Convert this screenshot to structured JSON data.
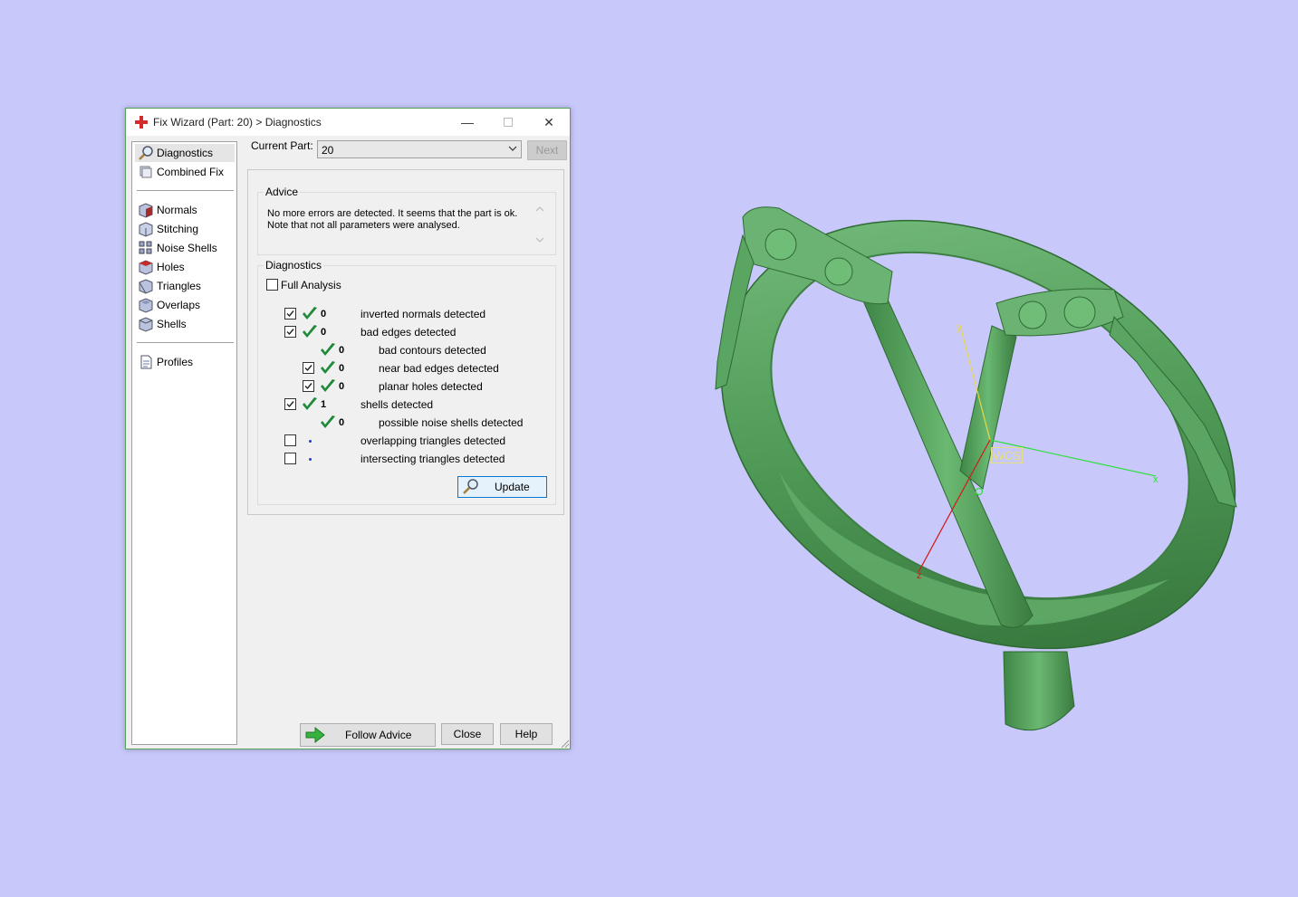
{
  "window": {
    "title": "Fix Wizard (Part: 20) > Diagnostics",
    "controls": {
      "minimize": "—",
      "close": "✕"
    }
  },
  "sidebar": {
    "top_items": [
      {
        "label": "Diagnostics",
        "icon": "magnifier-icon",
        "selected": true
      },
      {
        "label": "Combined Fix",
        "icon": "combined-fix-icon"
      }
    ],
    "fix_items": [
      {
        "label": "Normals",
        "icon": "normals-icon"
      },
      {
        "label": "Stitching",
        "icon": "stitching-icon"
      },
      {
        "label": "Noise Shells",
        "icon": "noise-shells-icon"
      },
      {
        "label": "Holes",
        "icon": "holes-icon"
      },
      {
        "label": "Triangles",
        "icon": "triangles-icon"
      },
      {
        "label": "Overlaps",
        "icon": "overlaps-icon"
      },
      {
        "label": "Shells",
        "icon": "shells-icon"
      }
    ],
    "bottom_items": [
      {
        "label": "Profiles",
        "icon": "profiles-icon"
      }
    ]
  },
  "current_part": {
    "label": "Current Part:",
    "value": "20"
  },
  "next_label": "Next",
  "advice": {
    "legend": "Advice",
    "line1": "No more errors are detected. It seems that the part is ok.",
    "line2": "Note that not all parameters were analysed."
  },
  "diagnostics": {
    "legend": "Diagnostics",
    "full_analysis_label": "Full Analysis",
    "full_analysis_checked": false,
    "rows": [
      {
        "has_checkbox": true,
        "checked": true,
        "status": "ok",
        "count": "0",
        "label": "inverted normals detected",
        "indent": 0
      },
      {
        "has_checkbox": true,
        "checked": true,
        "status": "ok",
        "count": "0",
        "label": "bad edges detected",
        "indent": 0
      },
      {
        "has_checkbox": false,
        "checked": false,
        "status": "ok",
        "count": "0",
        "label": "bad contours detected",
        "indent": 1
      },
      {
        "has_checkbox": true,
        "checked": true,
        "status": "ok",
        "count": "0",
        "label": "near bad edges detected",
        "indent": 1
      },
      {
        "has_checkbox": true,
        "checked": true,
        "status": "ok",
        "count": "0",
        "label": "planar holes detected",
        "indent": 1
      },
      {
        "has_checkbox": true,
        "checked": true,
        "status": "ok",
        "count": "1",
        "label": "shells detected",
        "indent": 0
      },
      {
        "has_checkbox": false,
        "checked": false,
        "status": "ok",
        "count": "0",
        "label": "possible noise shells detected",
        "indent": 1
      },
      {
        "has_checkbox": true,
        "checked": false,
        "status": "pending",
        "count": "",
        "label": "overlapping triangles detected",
        "indent": 0
      },
      {
        "has_checkbox": true,
        "checked": false,
        "status": "pending",
        "count": "",
        "label": "intersecting triangles detected",
        "indent": 0
      }
    ],
    "update_label": "Update"
  },
  "footer": {
    "follow_advice_label": "Follow Advice",
    "close_label": "Close",
    "help_label": "Help"
  },
  "viewport": {
    "wcs_label": "WCS",
    "axis_x": "x",
    "axis_y": "y",
    "axis_z": "z",
    "background_color": "#c8c8fb",
    "model_color": "#5aa862"
  }
}
